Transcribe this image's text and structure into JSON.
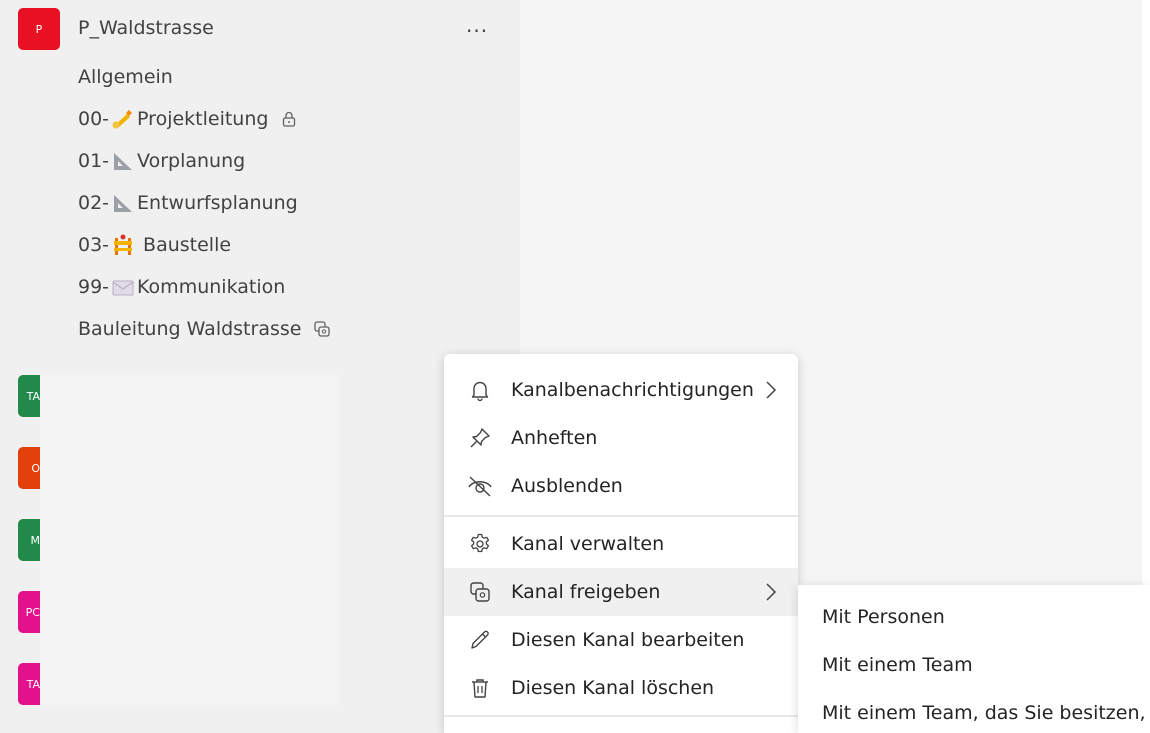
{
  "team": {
    "avatar_letter": "P",
    "name": "P_Waldstrasse",
    "more_label": "...",
    "color": "#e81123"
  },
  "channels": [
    {
      "prefix": "00-",
      "name": "Projektleitung",
      "icon": "writing-hand-emoji",
      "suffix_icon": "lock-icon"
    },
    {
      "prefix": "01-",
      "name": "Vorplanung",
      "icon": "triangular-ruler-emoji"
    },
    {
      "prefix": "02-",
      "name": "Entwurfsplanung",
      "icon": "triangular-ruler-emoji"
    },
    {
      "prefix": "03-",
      "name": "Baustelle",
      "icon": "construction-emoji"
    },
    {
      "prefix": "99-",
      "name": "Kommunikation",
      "icon": "envelope-emoji"
    }
  ],
  "channel_general": "Allgemein",
  "channel_shared": {
    "name": "Bauleitung Waldstrasse",
    "suffix_icon": "shared-channel-icon"
  },
  "other_teams": [
    {
      "letter": "TA",
      "color": "#218a4a"
    },
    {
      "letter": "O",
      "color": "#e3400b"
    },
    {
      "letter": "M",
      "color": "#218a4a"
    },
    {
      "letter": "PC",
      "color": "#e3118c"
    },
    {
      "letter": "TA",
      "color": "#e3118c"
    }
  ],
  "context_menu": {
    "items": [
      {
        "label": "Kanalbenachrichtigungen",
        "icon": "bell-icon",
        "submenu": true
      },
      {
        "label": "Anheften",
        "icon": "pin-icon"
      },
      {
        "label": "Ausblenden",
        "icon": "eye-off-icon"
      },
      {
        "label": "Kanal verwalten",
        "icon": "gear-icon"
      },
      {
        "label": "Kanal freigeben",
        "icon": "share-channel-icon",
        "submenu": true,
        "active": true
      },
      {
        "label": "Diesen Kanal bearbeiten",
        "icon": "pencil-icon"
      },
      {
        "label": "Diesen Kanal löschen",
        "icon": "trash-icon"
      }
    ]
  },
  "share_submenu": {
    "items": [
      "Mit Personen",
      "Mit einem Team",
      "Mit einem Team, das Sie besitzen,"
    ]
  }
}
